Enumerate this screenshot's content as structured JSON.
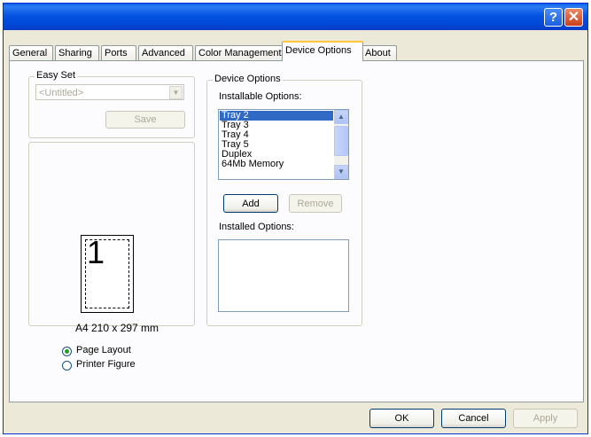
{
  "window": {
    "help_glyph": "?",
    "close_glyph": "✕"
  },
  "tabs": [
    {
      "label": "General"
    },
    {
      "label": "Sharing"
    },
    {
      "label": "Ports"
    },
    {
      "label": "Advanced"
    },
    {
      "label": "Color Management"
    },
    {
      "label": "Device Options",
      "active": true
    },
    {
      "label": "About"
    }
  ],
  "easy_set": {
    "title": "Easy Set",
    "combo_value": "<Untitled>",
    "save_label": "Save"
  },
  "preview": {
    "page_number": "1",
    "paper_size": "A4 210 x 297 mm",
    "radio_page_layout": "Page Layout",
    "radio_printer_figure": "Printer Figure",
    "selected_radio": "Page Layout"
  },
  "device_options": {
    "title": "Device Options",
    "installable_label": "Installable Options:",
    "installable_items": [
      "Tray 2",
      "Tray 3",
      "Tray 4",
      "Tray 5",
      "Duplex",
      "64Mb Memory"
    ],
    "selected_item": "Tray 2",
    "add_label": "Add",
    "remove_label": "Remove",
    "installed_label": "Installed Options:",
    "installed_items": []
  },
  "footer": {
    "ok_label": "OK",
    "cancel_label": "Cancel",
    "apply_label": "Apply"
  },
  "colors": {
    "titlebar": "#0553e1",
    "dialog_bg": "#ece9d8",
    "selection": "#316ac5",
    "active_tab_accent": "#ffc83c"
  }
}
